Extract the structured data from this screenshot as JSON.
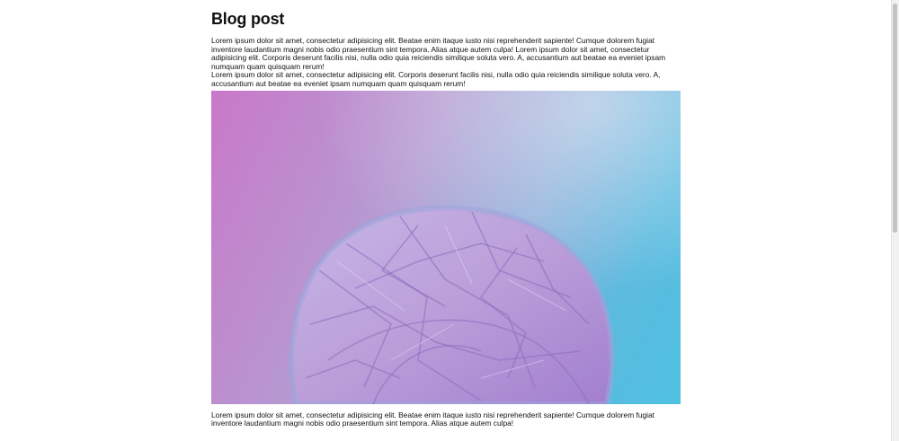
{
  "post": {
    "title": "Blog post",
    "paragraph_1": "Lorem ipsum dolor sit amet, consectetur adipisicing elit. Beatae enim itaque iusto nisi reprehenderit sapiente! Cumque dolorem fugiat inventore laudantium magni nobis odio praesentium sint tempora. Alias atque autem culpa! Lorem ipsum dolor sit amet, consectetur adipisicing elit. Corporis deserunt facilis nisi, nulla odio quia reiciendis similique soluta vero. A, accusantium aut beatae ea eveniet ipsam numquam quam quisquam rerum!",
    "paragraph_2": "Lorem ipsum dolor sit amet, consectetur adipisicing elit. Corporis deserunt facilis nisi, nulla odio quia reiciendis similique soluta vero. A, accusantium aut beatae ea eveniet ipsam numquam quam quisquam rerum!",
    "paragraph_3": "Lorem ipsum dolor sit amet, consectetur adipisicing elit. Beatae enim itaque iusto nisi reprehenderit sapiente! Cumque dolorem fugiat inventore laudantium magni nobis odio praesentium sint tempora. Alias atque autem culpa!"
  },
  "hero_image": {
    "colors": {
      "pink": "#c978c9",
      "lavender": "#b59bd2",
      "blue": "#4ec0e0"
    }
  }
}
